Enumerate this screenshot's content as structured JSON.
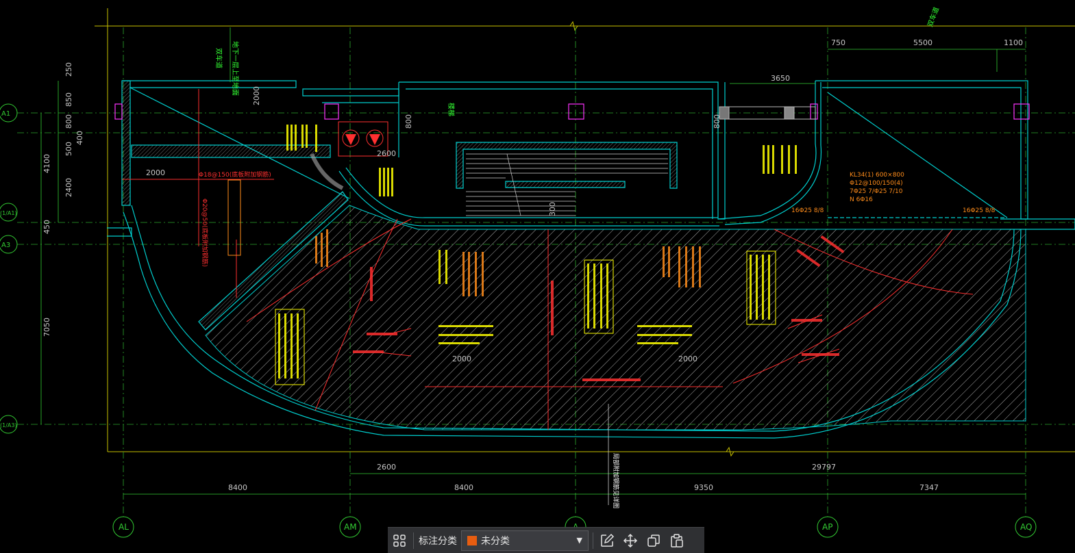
{
  "colors": {
    "background": "#000000",
    "wall": "#00d0d0",
    "axis": "#33cc33",
    "annotation_yellow": "#ffff00",
    "annotation_orange": "#ff8c1a",
    "annotation_red": "#ff3030",
    "dimension": "#c8c8c8",
    "category_swatch": "#e85d10"
  },
  "axes": {
    "vertical": [
      "AL",
      "AM",
      "A",
      "AP",
      "AQ"
    ],
    "horizontal": [
      "A1",
      "(1/A1)",
      "A3",
      "(1/A3)"
    ]
  },
  "dimensions": {
    "bottom_row1": [
      "2600",
      "29797"
    ],
    "bottom_row2": [
      "8400",
      "8400",
      "9350",
      "7347"
    ],
    "top_right": [
      "750",
      "5500",
      "1100"
    ],
    "top_mid": "3650",
    "left": [
      "250",
      "850",
      "800",
      "400",
      "500",
      "4100",
      "2400",
      "450",
      "7050"
    ],
    "inner": [
      "2000",
      "2600",
      "800",
      "300",
      "800",
      "2000",
      "2000",
      "2000"
    ]
  },
  "annotations": {
    "kl34": [
      "KL34(1) 600×800",
      "Φ12@100/150(4)",
      "7Φ25 7/Φ25 7/10",
      "N 6Φ16"
    ],
    "rebar_right": [
      "16Φ25 8/8",
      "16Φ25 8/8"
    ],
    "rebar_left": [
      "Φ18@150(底板附加钢筋)",
      "Φ20@50(底板附加钢筋)"
    ],
    "top_green": [
      "地下一层上至地面",
      "双车道"
    ],
    "top_right_green": "双车道",
    "stair_label": "楼梯",
    "bottom_note": "局部附加钢筋见详图"
  },
  "toolbar": {
    "grid_icon": "apps-grid-icon",
    "label": "标注分类",
    "select_value": "未分类",
    "actions": [
      "edit-icon",
      "move-icon",
      "copy-icon",
      "paste-icon"
    ]
  }
}
